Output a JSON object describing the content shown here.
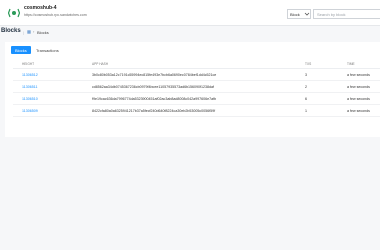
{
  "header": {
    "app_name": "cosmoshub-4",
    "app_url": "https://cosmoshub.rpc.sandwiches.com",
    "search_type": "Block",
    "search_placeholder": "Search by block"
  },
  "breadcrumb": {
    "title": "Blocks",
    "separator": "|",
    "arrow": "›",
    "current": "Blocks"
  },
  "tabs": [
    {
      "label": "Blocks",
      "active": true
    },
    {
      "label": "Transactions",
      "active": false
    }
  ],
  "table": {
    "headers": [
      "HEIGHT",
      "APP HASH",
      "TXS",
      "TIME"
    ],
    "rows": [
      {
        "height": "11306512",
        "hash": "3b0c80b053a12c7191c55994ec815fe493e7bcb6a0690ec0784bef1dd4c521ce",
        "txs": "3",
        "time": "a few seconds"
      },
      {
        "height": "11306511",
        "hash": "cd8562aa34db0745367236cb0979f4bcee11057935573ad6b156090f1238daf",
        "txs": "2",
        "time": "a few seconds"
      },
      {
        "height": "11306510",
        "hash": "f9e19cac636da7996774da5323900451af02ac3ab8ad8008c042a997606e7afb",
        "txs": "6",
        "time": "a few seconds"
      },
      {
        "height": "11306509",
        "hash": "8422cfa80a0a6325941217b37a5fecf240d640f8224ca30eb2b53005c0056f59f",
        "txs": "1",
        "time": "a few seconds"
      }
    ]
  },
  "colors": {
    "accent": "#1890ff",
    "logo": "#2b9a58"
  },
  "icons": {
    "logo": "app-logo-icon",
    "home": "home-icon",
    "select": "chevron-down-icon"
  }
}
